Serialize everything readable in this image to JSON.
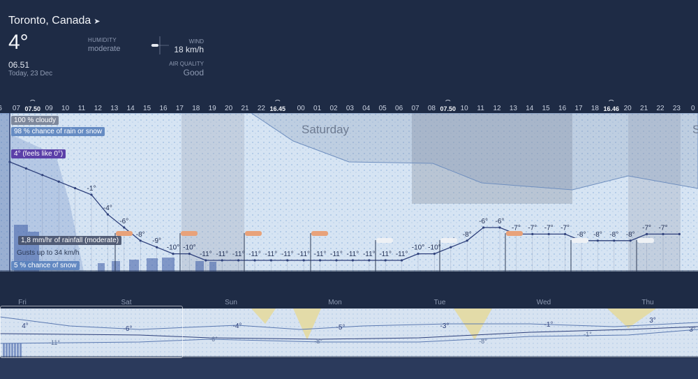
{
  "header": {
    "location": "Toronto, Canada",
    "location_icon": "location-arrow-icon",
    "temperature": "4°",
    "time": "06.51",
    "date": "Today, 23 Dec",
    "humidity_label": "HUMIDITY",
    "humidity_value": "moderate",
    "wind_label": "WIND",
    "wind_value": "18 km/h",
    "air_quality_label": "AIR QUALITY",
    "air_quality_value": "Good"
  },
  "timeline": {
    "hours": [
      "6",
      "07",
      "08",
      "09",
      "10",
      "11",
      "12",
      "13",
      "14",
      "15",
      "16",
      "17",
      "18",
      "19",
      "20",
      "21",
      "22",
      "23",
      "00",
      "01",
      "02",
      "03",
      "04",
      "05",
      "06",
      "07",
      "08",
      "09",
      "10",
      "11",
      "12",
      "13",
      "14",
      "15",
      "16",
      "17",
      "18",
      "19",
      "20",
      "21",
      "22",
      "23",
      "0"
    ],
    "sunrise_1": "07.50",
    "sunset_1": "16.45",
    "sunrise_2": "07.50",
    "sunset_2": "16.46",
    "temps": [
      "",
      "",
      "",
      "",
      "",
      "-1°",
      "-4°",
      "-6°",
      "-8°",
      "-9°",
      "-10°",
      "-10°",
      "-11°",
      "-11°",
      "-11°",
      "-11°",
      "-11°",
      "-11°",
      "-11°",
      "-11°",
      "-11°",
      "-11°",
      "-11°",
      "-11°",
      "-11°",
      "-10°",
      "-10°",
      "-9°",
      "-8°",
      "-6°",
      "-6°",
      "-7°",
      "-7°",
      "-7°",
      "-7°",
      "-8°",
      "-8°",
      "-8°",
      "-8°",
      "-7°",
      "-7°"
    ],
    "day_label": "Saturday",
    "next_day_initial": "S"
  },
  "tooltips": {
    "cloud": "100 % cloudy",
    "rain_chance": "98 % chance of rain or snow",
    "feels": "4° (feels like 0°)",
    "rainfall": "1,8 mm/hr of rainfall (moderate)",
    "gusts": "Gusts up to 34 km/h",
    "snow": "5 % chance of snow"
  },
  "week": {
    "days": [
      "Fri",
      "Sat",
      "Sun",
      "Mon",
      "Tue",
      "Wed",
      "Thu"
    ],
    "highs": [
      "4°",
      "-6°",
      "-4°",
      "-5°",
      "-3°",
      "-1°",
      "3°",
      "3°"
    ],
    "lows": [
      "-11°",
      "-6°",
      "-8°",
      "-8°",
      "-1°"
    ]
  },
  "colors": {
    "background": "#1e2b45",
    "temp_line": "#2d3f7a",
    "feels_badge": "#5b3fa8",
    "snow_band": "#cfe0f2"
  }
}
